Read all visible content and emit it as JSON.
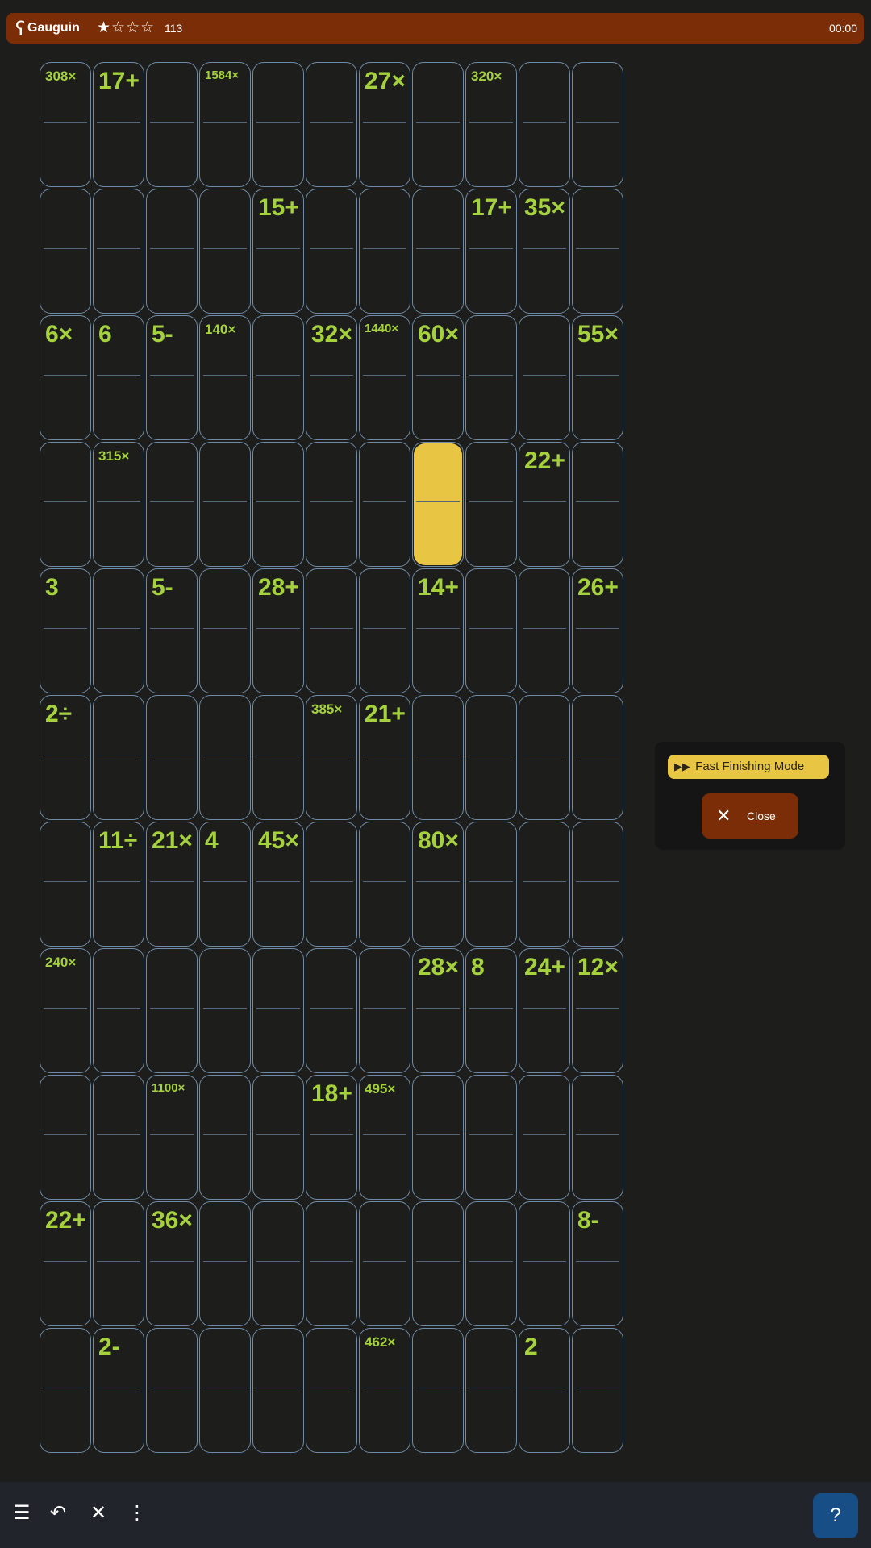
{
  "header": {
    "logo": "ʕ",
    "title": "Gauguin",
    "stars": "★☆☆☆",
    "count": "113",
    "timer": "00:00"
  },
  "popup": {
    "fast_finishing_label": "Fast Finishing Mode",
    "close_label": "Close"
  },
  "toolbar": {
    "menu_icon": "☰",
    "undo_icon": "↶",
    "clear_icon": "✕",
    "more_icon": "⋮",
    "help_label": "?"
  },
  "grid": {
    "rows": 11,
    "cols": 11
  },
  "clues": [
    {
      "text": "308×",
      "row": 0,
      "col": 0
    },
    {
      "text": "17+",
      "row": 0,
      "col": 1
    },
    {
      "text": "1584×",
      "row": 0,
      "col": 3
    },
    {
      "text": "27×",
      "row": 0,
      "col": 6
    },
    {
      "text": "320×",
      "row": 0,
      "col": 8
    },
    {
      "text": "15+",
      "row": 1,
      "col": 4
    },
    {
      "text": "17+",
      "row": 1,
      "col": 8
    },
    {
      "text": "35×",
      "row": 1,
      "col": 9
    },
    {
      "text": "6×",
      "row": 2,
      "col": 0
    },
    {
      "text": "6",
      "row": 2,
      "col": 1
    },
    {
      "text": "5-",
      "row": 2,
      "col": 2
    },
    {
      "text": "140×",
      "row": 2,
      "col": 3
    },
    {
      "text": "32×",
      "row": 2,
      "col": 5
    },
    {
      "text": "1440×",
      "row": 2,
      "col": 6
    },
    {
      "text": "60×",
      "row": 2,
      "col": 7
    },
    {
      "text": "55×",
      "row": 2,
      "col": 10
    },
    {
      "text": "315×",
      "row": 3,
      "col": 1
    },
    {
      "text": "22+",
      "row": 3,
      "col": 9
    },
    {
      "text": "3",
      "row": 4,
      "col": 0
    },
    {
      "text": "5-",
      "row": 4,
      "col": 2
    },
    {
      "text": "28+",
      "row": 4,
      "col": 4
    },
    {
      "text": "14+",
      "row": 4,
      "col": 7
    },
    {
      "text": "26+",
      "row": 4,
      "col": 10
    },
    {
      "text": "2÷",
      "row": 5,
      "col": 0
    },
    {
      "text": "385×",
      "row": 5,
      "col": 5
    },
    {
      "text": "21+",
      "row": 5,
      "col": 6
    },
    {
      "text": "11÷",
      "row": 6,
      "col": 1
    },
    {
      "text": "21×",
      "row": 6,
      "col": 2
    },
    {
      "text": "4",
      "row": 6,
      "col": 3
    },
    {
      "text": "45×",
      "row": 6,
      "col": 4
    },
    {
      "text": "80×",
      "row": 6,
      "col": 7
    },
    {
      "text": "240×",
      "row": 7,
      "col": 0
    },
    {
      "text": "28×",
      "row": 7,
      "col": 7
    },
    {
      "text": "8",
      "row": 7,
      "col": 8
    },
    {
      "text": "24+",
      "row": 7,
      "col": 9
    },
    {
      "text": "12×",
      "row": 7,
      "col": 10
    },
    {
      "text": "1100×",
      "row": 8,
      "col": 2
    },
    {
      "text": "18+",
      "row": 8,
      "col": 5
    },
    {
      "text": "495×",
      "row": 8,
      "col": 6
    },
    {
      "text": "22+",
      "row": 9,
      "col": 0
    },
    {
      "text": "36×",
      "row": 9,
      "col": 2
    },
    {
      "text": "8-",
      "row": 9,
      "col": 10
    },
    {
      "text": "2-",
      "row": 10,
      "col": 1
    },
    {
      "text": "462×",
      "row": 10,
      "col": 6
    },
    {
      "text": "2",
      "row": 10,
      "col": 9
    }
  ],
  "selected_cell": {
    "row": 3,
    "col": 7
  }
}
